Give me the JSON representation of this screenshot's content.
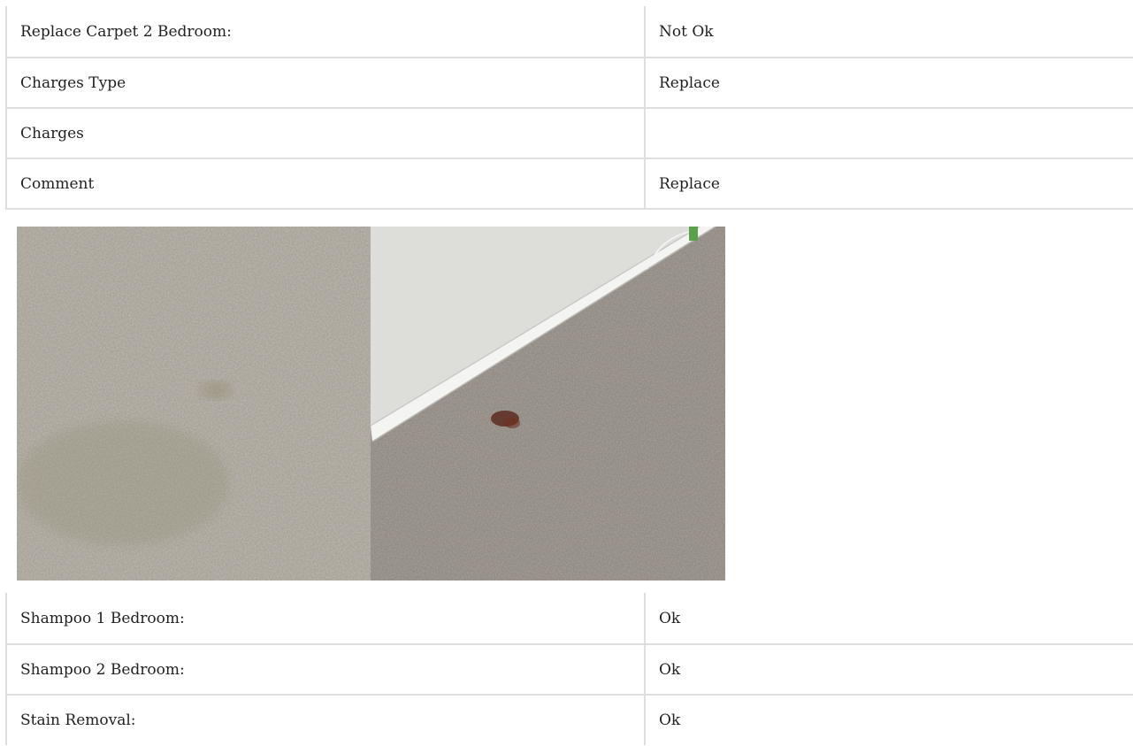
{
  "top_rows": [
    {
      "label": "Replace Carpet 2 Bedroom:",
      "value": "Not Ok"
    },
    {
      "label": "Charges Type",
      "value": "Replace"
    },
    {
      "label": "Charges",
      "value": ""
    },
    {
      "label": "Comment",
      "value": "Replace"
    }
  ],
  "bottom_rows": [
    {
      "label": "Shampoo 1 Bedroom:",
      "value": "Ok"
    },
    {
      "label": "Shampoo 2 Bedroom:",
      "value": "Ok"
    },
    {
      "label": "Stain Removal:",
      "value": "Ok"
    }
  ],
  "photo": {
    "carpet_color": "#9c958c",
    "wall_color": "#e4e4e2"
  }
}
